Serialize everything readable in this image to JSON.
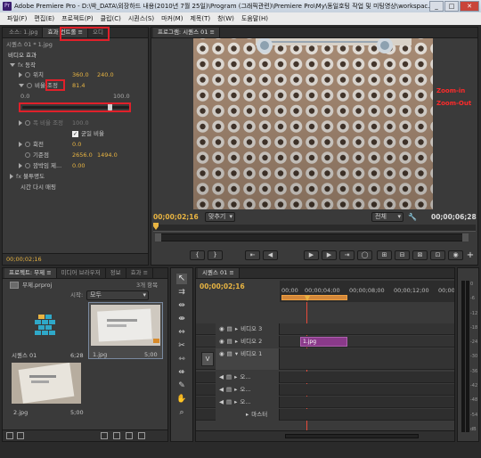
{
  "window": {
    "title": "Adobe Premiere Pro - D:\\박_DATA\\외장하드 내용(2010년 7월 25일)\\Program (그래픽관련)\\Premiere Pro\\My\\동일호팅 작업 및 미팅영상\\workspac...",
    "min": "_",
    "max": "□",
    "close": "✕"
  },
  "menu": [
    "파일(F)",
    "편집(E)",
    "프로젝트(P)",
    "클립(C)",
    "시퀀스(S)",
    "마커(M)",
    "제목(T)",
    "창(W)",
    "도움말(H)"
  ],
  "effects": {
    "tabs": [
      "소스: 1.jpg",
      "효과 컨트롤 ≡",
      "오디"
    ],
    "seq_title": "시퀀스 01 * 1.jpg",
    "video_effects": "비디오 효과",
    "motion": "동작",
    "position": {
      "label": "위치",
      "x": "360.0",
      "y": "240.0"
    },
    "scale": {
      "label": "비율 조정",
      "value": "81.4"
    },
    "slider": {
      "min": "0.0",
      "max": "100.0",
      "level": 0.814
    },
    "scale_width": {
      "label": "폭 비율 조정",
      "value": "100.0"
    },
    "uniform": {
      "label": "균일 비율",
      "check": "✓"
    },
    "rotation": {
      "label": "회전",
      "value": "0.0"
    },
    "anchor": {
      "label": "기준점",
      "x": "2656.0",
      "y": "1494.0"
    },
    "flicker": {
      "label": "깜박임 제...",
      "value": "0.00"
    },
    "opacity": "불투명도",
    "time_remap": "시간 다시 매핑",
    "timecode": "00;00;02;16"
  },
  "program": {
    "tab": "프로그램: 시퀀스 01 ≡",
    "zoom_in": "Zoom-in",
    "zoom_out": "Zoom-Out",
    "current_time": "00;00;02;16",
    "fit": "맞추기",
    "quality": "전체",
    "duration": "00;00;06;28",
    "transport": [
      "{",
      "}",
      "⇤",
      "◀",
      "▶",
      "▶",
      "⇥",
      "◯",
      "⊞",
      "⊟",
      "⊠",
      "⊡",
      "◉"
    ]
  },
  "project": {
    "tabs": [
      "프로젝트: 무제 ≡",
      "미디어 브라우저",
      "정보",
      "효과 ≡"
    ],
    "file": "무제.prproj",
    "count": "3개 항목",
    "in_label": "시작:",
    "in_value": "모두",
    "items": [
      {
        "name": "시퀀스 01",
        "duration": "6;28"
      },
      {
        "name": "1.jpg",
        "duration": "5;00"
      },
      {
        "name": "2.jpg",
        "duration": "5;00"
      }
    ]
  },
  "timeline": {
    "tab": "시퀀스 01 ≡",
    "timecode": "00;00;02;16",
    "ruler": [
      "00;00",
      "00;00;04;00",
      "00;00;08;00",
      "00;00;12;00",
      "00;00;16;00"
    ],
    "tracks": [
      {
        "name": "비디오 3"
      },
      {
        "name": "비디오 2",
        "clip": "1.jpg"
      },
      {
        "name": "비디오 1"
      },
      {
        "name": "오..."
      },
      {
        "name": "오..."
      },
      {
        "name": "오..."
      },
      {
        "name": "마스터"
      }
    ],
    "v_label": "V"
  },
  "meter": {
    "labels": [
      "0",
      "-6",
      "-12",
      "-18",
      "-24",
      "-30",
      "-36",
      "-42",
      "-48",
      "-54",
      "dB"
    ]
  },
  "colors": {
    "accent": "#e8b442",
    "highlight": "#e0202a",
    "clip": "#8a3a8a"
  }
}
